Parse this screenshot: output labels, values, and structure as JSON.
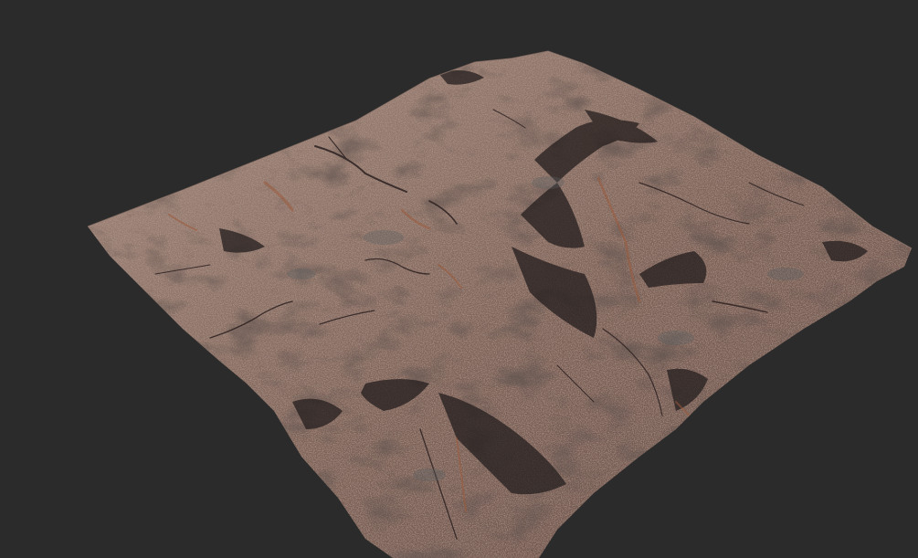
{
  "viewport": {
    "background_color": "#2b2b2b"
  },
  "terrain": {
    "type": "3d-heightmap-render",
    "base_color": "#7a5e52",
    "highlight_color": "#a4877a",
    "shadow_color": "#2a2222",
    "accent_color": "#9a5a3a",
    "moss_color": "#5a5e62"
  }
}
